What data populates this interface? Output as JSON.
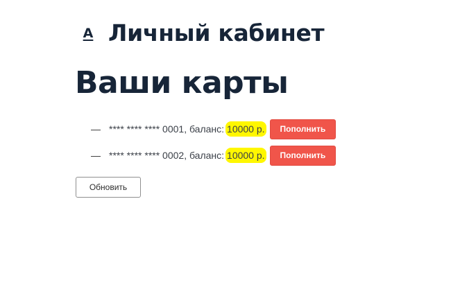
{
  "header": {
    "logo": "A",
    "title": "Личный кабинет"
  },
  "page_title": "Ваши карты",
  "cards": [
    {
      "dash": "—",
      "label": "**** **** **** 0001, баланс:",
      "balance": "10000 р.",
      "button": "Пополнить"
    },
    {
      "dash": "—",
      "label": "**** **** **** 0002, баланс:",
      "balance": "10000 р.",
      "button": "Пополнить"
    }
  ],
  "refresh_button": "Обновить",
  "colors": {
    "heading": "#172538",
    "highlight": "#fff700",
    "topup_button": "#f0554a"
  }
}
